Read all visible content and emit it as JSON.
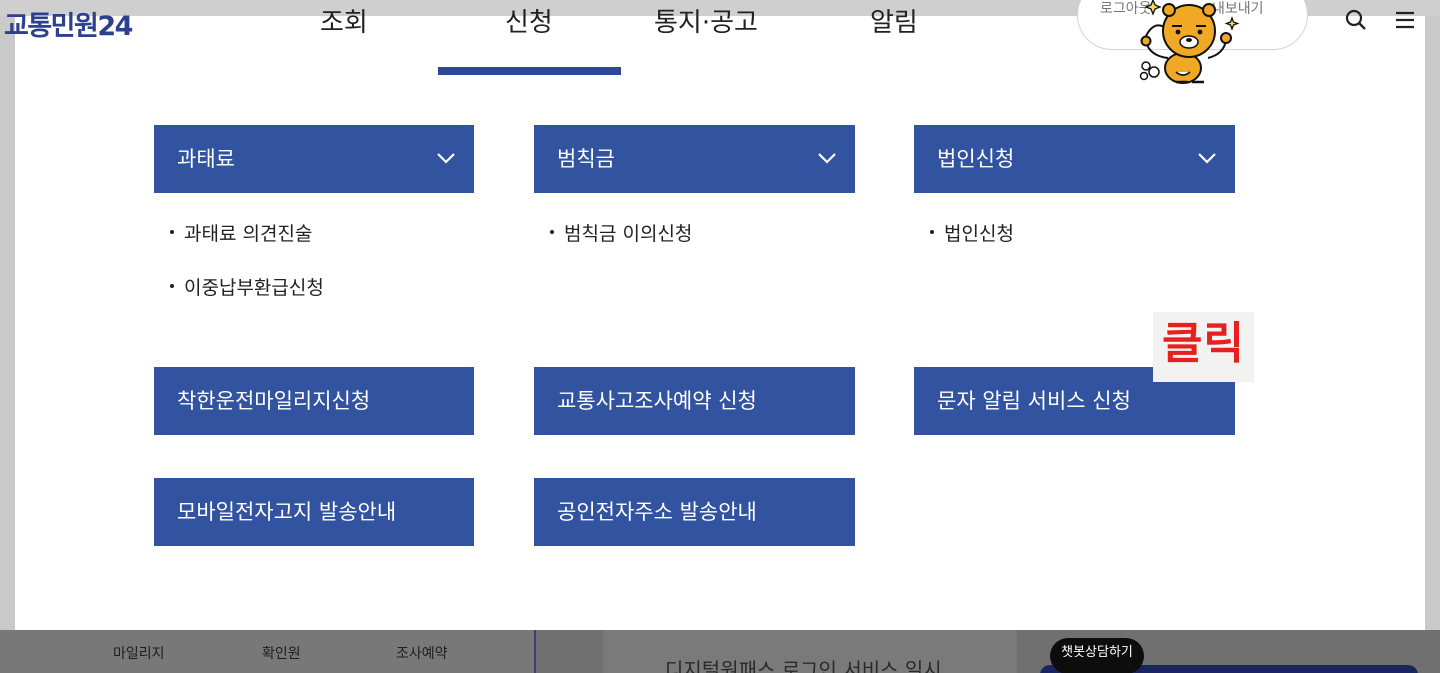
{
  "header": {
    "logo": "교통민원24",
    "nav": [
      "조회",
      "신청",
      "통지·공고",
      "알림"
    ],
    "login": "로그아웃",
    "export": "내보내기"
  },
  "categories": [
    {
      "label": "과태료",
      "items": [
        "과태료 의견진술",
        "이중납부환급신청"
      ]
    },
    {
      "label": "범칙금",
      "items": [
        "범칙금 이의신청"
      ]
    },
    {
      "label": "법인신청",
      "items": [
        "법인신청"
      ]
    }
  ],
  "links": [
    "착한운전마일리지신청",
    "교통사고조사예약 신청",
    "문자 알림 서비스 신청",
    "모바일전자고지 발송안내",
    "공인전자주소 발송안내"
  ],
  "annotation": {
    "label": "클릭",
    "color": "#e62020"
  },
  "bottom": {
    "links": [
      "마일리지",
      "확인원",
      "조사예약"
    ],
    "notice": "디지털원패스 로그인 서비스 일시 ...",
    "chatbot": "챗봇상담하기"
  },
  "colors": {
    "primary": "#32539f",
    "brand": "#2d3f8f"
  }
}
